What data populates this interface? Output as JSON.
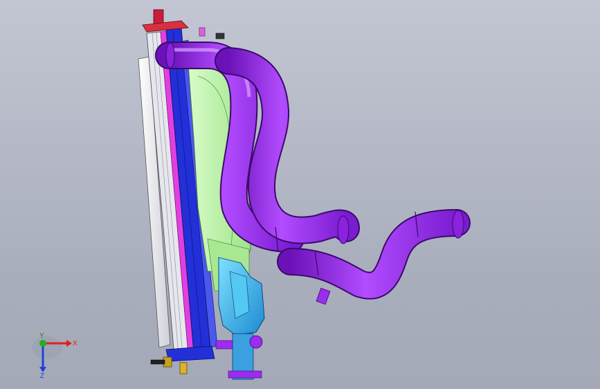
{
  "viewport": {
    "background_top": "#c3c6d2",
    "background_bottom": "#a4a9b8"
  },
  "model": {
    "parts": [
      {
        "name": "radiator-core",
        "color": "#e9e9ee"
      },
      {
        "name": "radiator-tank",
        "color": "#2330d8"
      },
      {
        "name": "fan-shroud",
        "color": "#b9f2a3"
      },
      {
        "name": "upper-hose",
        "color": "#9b2cf0"
      },
      {
        "name": "lower-hose",
        "color": "#9b2cf0"
      },
      {
        "name": "overflow-bottle",
        "color": "#2fb4e8"
      },
      {
        "name": "seal-strip",
        "color": "#e23fe0"
      },
      {
        "name": "mount-bracket",
        "color": "#c81e3a"
      },
      {
        "name": "drain-fitting",
        "color": "#c7a21f"
      }
    ]
  },
  "triad": {
    "x_label": "X",
    "y_label": "Y",
    "z_label": "Z",
    "x_color": "#e02020",
    "y_color": "#20b020",
    "z_color": "#2040e0"
  }
}
